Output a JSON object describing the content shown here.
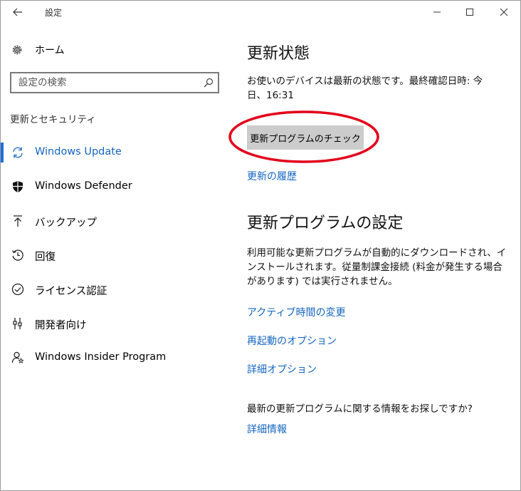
{
  "window": {
    "title": "設定"
  },
  "sidebar": {
    "home_label": "ホーム",
    "search_placeholder": "設定の検索",
    "section_heading": "更新とセキュリティ",
    "items": [
      {
        "label": "Windows Update",
        "icon": "sync-icon",
        "active": true
      },
      {
        "label": "Windows Defender",
        "icon": "shield-icon",
        "active": false
      },
      {
        "label": "バックアップ",
        "icon": "upload-arrow-icon",
        "active": false
      },
      {
        "label": "回復",
        "icon": "history-icon",
        "active": false
      },
      {
        "label": "ライセンス認証",
        "icon": "check-circle-icon",
        "active": false
      },
      {
        "label": "開発者向け",
        "icon": "developer-tools-icon",
        "active": false
      },
      {
        "label": "Windows Insider Program",
        "icon": "insider-person-icon",
        "active": false
      }
    ]
  },
  "main": {
    "status_heading": "更新状態",
    "status_text": "お使いのデバイスは最新の状態です。最終確認日時: 今日、16:31",
    "check_button_label": "更新プログラムのチェック",
    "history_link": "更新の履歴",
    "settings_heading": "更新プログラムの設定",
    "settings_text": "利用可能な更新プログラムが自動的にダウンロードされ、インストールされます。従量制課金接続 (料金が発生する場合があります) では実行されません。",
    "links": {
      "active_hours": "アクティブ時間の変更",
      "restart_options": "再起動のオプション",
      "advanced_options": "詳細オプション"
    },
    "info_question": "最新の更新プログラムに関する情報をお探しですか?",
    "info_link": "詳細情報"
  },
  "colors": {
    "accent": "#1565c0",
    "annotation": "#e3001b",
    "button_bg": "#cccccc"
  }
}
